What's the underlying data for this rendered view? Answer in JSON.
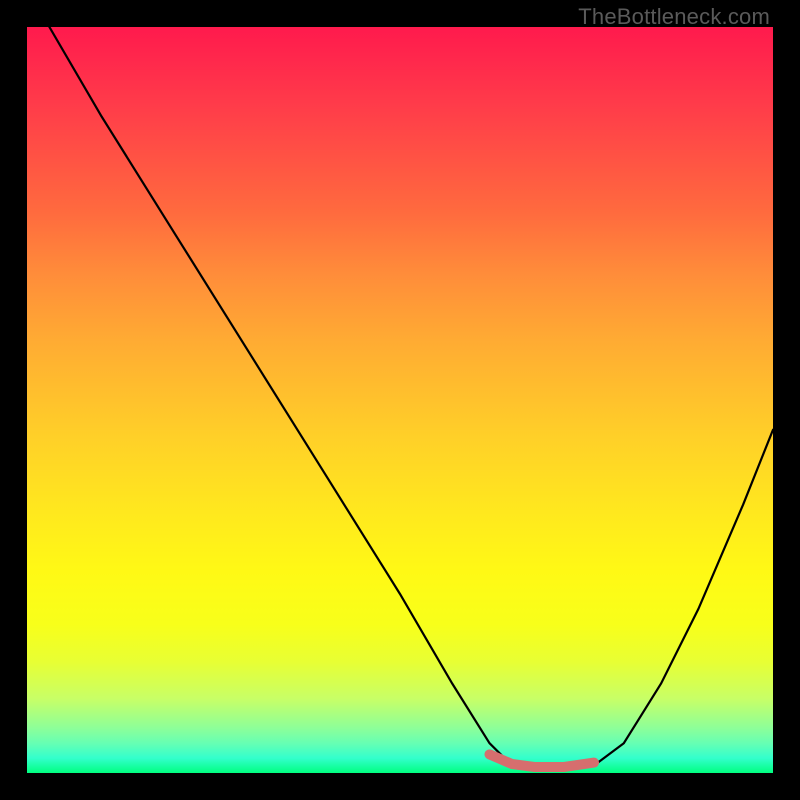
{
  "watermark": "TheBottleneck.com",
  "chart_data": {
    "type": "line",
    "title": "",
    "xlabel": "",
    "ylabel": "",
    "xlim": [
      0,
      100
    ],
    "ylim": [
      0,
      100
    ],
    "grid": false,
    "series": [
      {
        "name": "bottleneck-curve",
        "x": [
          3,
          10,
          20,
          30,
          40,
          50,
          57,
          62,
          65,
          68,
          72,
          76,
          80,
          85,
          90,
          96,
          100
        ],
        "values": [
          100,
          88,
          72,
          56,
          40,
          24,
          12,
          4,
          1,
          0.5,
          0.5,
          1,
          4,
          12,
          22,
          36,
          46
        ]
      }
    ],
    "highlight": {
      "name": "optimal-zone",
      "x": [
        62,
        65,
        68,
        72,
        76
      ],
      "values": [
        2.5,
        1.2,
        0.8,
        0.8,
        1.4
      ],
      "color": "#d66e6e"
    },
    "gradient_stops": [
      {
        "pos": 0,
        "color": "#ff1a4d"
      },
      {
        "pos": 50,
        "color": "#ffd028"
      },
      {
        "pos": 80,
        "color": "#f8ff1a"
      },
      {
        "pos": 100,
        "color": "#00ff80"
      }
    ]
  }
}
